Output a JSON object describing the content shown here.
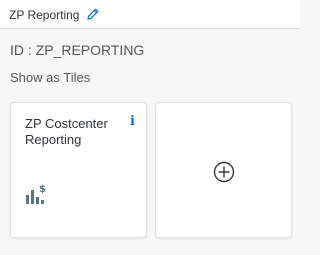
{
  "header": {
    "title": "ZP Reporting",
    "edit_icon": "pencil-icon"
  },
  "group": {
    "id_text": "ID : ZP_REPORTING",
    "show_tiles_label": "Show as Tiles"
  },
  "tiles": [
    {
      "title": "ZP Costcenter Reporting",
      "info_symbol": "i",
      "icon": "bar-chart-dollar-icon"
    }
  ],
  "add_tile": {
    "icon": "add-circle-icon"
  },
  "colors": {
    "accent": "#0a6ed1",
    "icon_blue": "#5b738b",
    "text": "#32363a"
  }
}
